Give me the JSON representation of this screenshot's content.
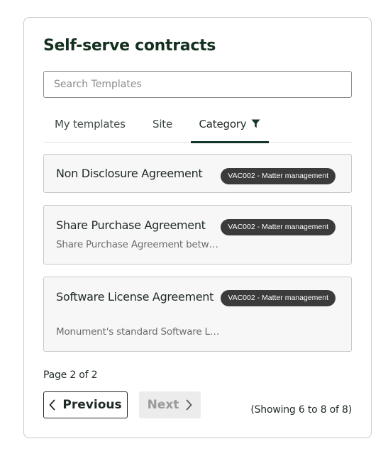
{
  "header": {
    "title": "Self-serve contracts"
  },
  "search": {
    "placeholder": "Search Templates",
    "value": ""
  },
  "tabs": [
    {
      "label": "My templates",
      "active": false
    },
    {
      "label": "Site",
      "active": false
    },
    {
      "label": "Category",
      "active": true,
      "icon": "filter-icon"
    }
  ],
  "templates": [
    {
      "title": "Non Disclosure Agreement",
      "description": "",
      "badge": "VAC002 - Matter management"
    },
    {
      "title": "Share Purchase Agreement",
      "description": "Share Purchase Agreement betw…",
      "badge": "VAC002 - Matter management"
    },
    {
      "title": "Software License Agreement",
      "description": "Monument's standard Software L…",
      "badge": "VAC002 - Matter management"
    }
  ],
  "pagination": {
    "page_label": "Page 2 of 2",
    "previous_label": "Previous",
    "next_label": "Next",
    "next_disabled": true,
    "showing": "(Showing 6 to 8 of 8)"
  },
  "colors": {
    "accent": "#15342a",
    "badge_bg": "#3b3b3b",
    "card_bg": "#f7f7f7"
  }
}
